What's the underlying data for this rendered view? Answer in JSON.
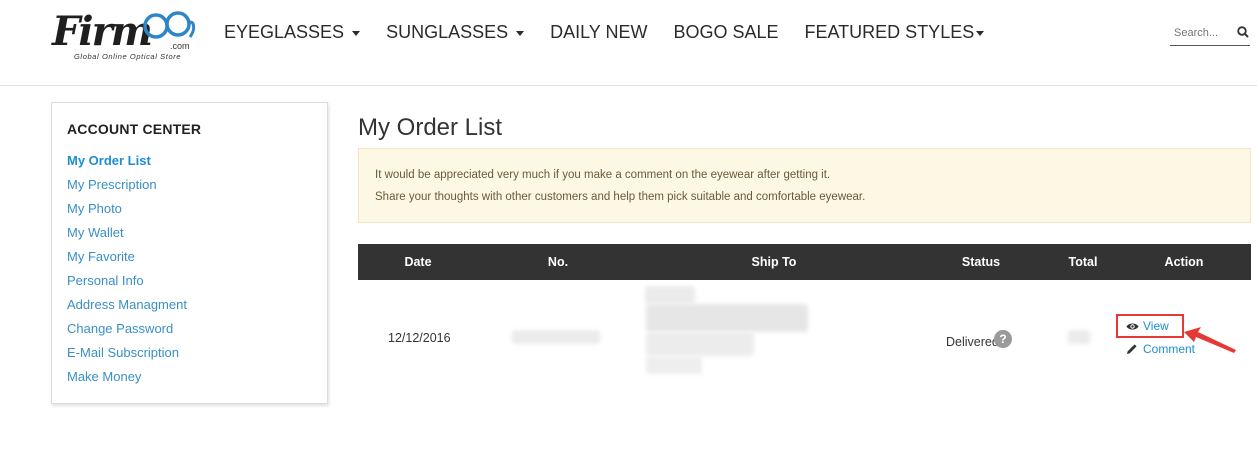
{
  "brand": {
    "name": "Firm",
    "suffix": ".com",
    "tagline": "Global Online Optical Store"
  },
  "nav": {
    "items": [
      {
        "label": "EYEGLASSES",
        "dropdown": true
      },
      {
        "label": "SUNGLASSES",
        "dropdown": true
      },
      {
        "label": "DAILY NEW",
        "dropdown": false
      },
      {
        "label": "BOGO SALE",
        "dropdown": false
      },
      {
        "label": "FEATURED STYLES",
        "dropdown": true
      }
    ]
  },
  "search": {
    "placeholder": "Search...",
    "icon": "search-icon"
  },
  "sidebar": {
    "title": "ACCOUNT CENTER",
    "items": [
      {
        "label": "My Order List",
        "active": true
      },
      {
        "label": "My Prescription"
      },
      {
        "label": "My Photo"
      },
      {
        "label": "My Wallet"
      },
      {
        "label": "My Favorite"
      },
      {
        "label": "Personal Info"
      },
      {
        "label": "Address Managment"
      },
      {
        "label": "Change Password"
      },
      {
        "label": "E-Mail Subscription"
      },
      {
        "label": "Make Money"
      }
    ]
  },
  "main": {
    "title": "My Order List",
    "notice": {
      "line1": "It would be appreciated very much if you make a comment on the eyewear after getting it.",
      "line2": "Share your thoughts with other customers and help them pick suitable and comfortable eyewear."
    },
    "table": {
      "headers": [
        "Date",
        "No.",
        "Ship To",
        "Status",
        "Total",
        "Action"
      ],
      "rows": [
        {
          "date": "12/12/2016",
          "status": "Delivered",
          "help": "?",
          "actions": {
            "view": "View",
            "comment": "Comment"
          }
        }
      ]
    }
  },
  "colors": {
    "link": "#1d8ed3",
    "table_header": "#333333",
    "notice_bg": "#fcf8e3",
    "highlight": "#e53935"
  }
}
